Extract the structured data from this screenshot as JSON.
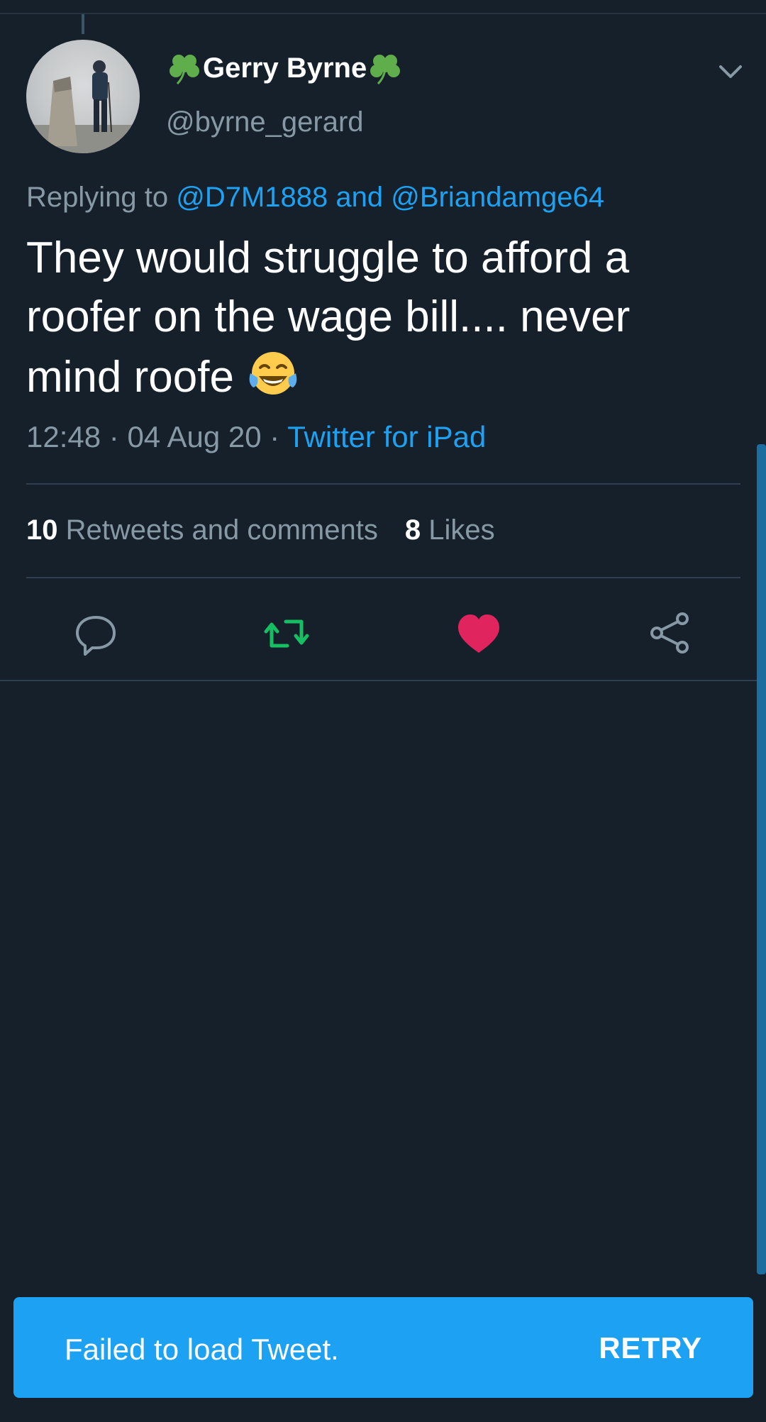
{
  "tweet": {
    "author_name": "Gerry Byrne",
    "author_handle": "@byrne_gerard",
    "replying_prefix": "Replying to ",
    "reply_user_1": "@D7M1888",
    "reply_joiner": " and ",
    "reply_user_2": "@Briandamge64",
    "text": "They would struggle to afford a roofer on the wage bill.... never mind roofe ",
    "time": "12:48",
    "date": "04 Aug 20",
    "separator": " · ",
    "client": "Twitter for iPad"
  },
  "stats": {
    "retweets_count": "10",
    "retweets_label": "Retweets and comments",
    "likes_count": "8",
    "likes_label": "Likes"
  },
  "actions": {
    "reply_icon": "comment-icon",
    "retweet_icon": "retweet-icon",
    "like_icon": "heart-icon",
    "share_icon": "share-icon"
  },
  "toast": {
    "message": "Failed to load Tweet.",
    "action": "RETRY"
  },
  "colors": {
    "background": "#15202b",
    "accent": "#1da1f2",
    "retweet_green": "#17bf63",
    "like_red": "#e0245e",
    "secondary_text": "#8899a6"
  }
}
